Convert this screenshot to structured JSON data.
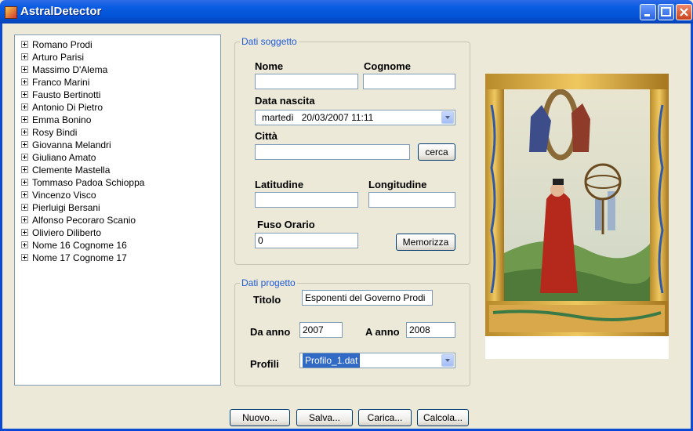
{
  "window": {
    "title": "AstralDetector"
  },
  "tree": {
    "items": [
      "Romano Prodi",
      "Arturo  Parisi",
      "Massimo D'Alema",
      "Franco Marini",
      "Fausto Bertinotti",
      "Antonio  Di Pietro",
      "Emma Bonino",
      "Rosy Bindi",
      "Giovanna Melandri",
      "Giuliano Amato",
      "Clemente Mastella",
      "Tommaso Padoa Schioppa",
      "Vincenzo Visco",
      "Pierluigi Bersani",
      "Alfonso  Pecoraro Scanio",
      "Oliviero  Diliberto",
      "Nome 16 Cognome 16",
      "Nome 17 Cognome 17"
    ]
  },
  "soggetto": {
    "legend": "Dati soggetto",
    "nome_label": "Nome",
    "nome_value": "",
    "cognome_label": "Cognome",
    "cognome_value": "",
    "data_label": "Data nascita",
    "data_day": "martedì",
    "data_value": "20/03/2007 11:11",
    "citta_label": "Città",
    "citta_value": "",
    "cerca_label": "cerca",
    "lat_label": "Latitudine",
    "lat_value": "",
    "lon_label": "Longitudine",
    "lon_value": "",
    "fuso_label": "Fuso Orario",
    "fuso_value": "0",
    "memorizza_label": "Memorizza"
  },
  "progetto": {
    "legend": "Dati progetto",
    "titolo_label": "Titolo",
    "titolo_value": "Esponenti del Governo Prodi",
    "da_anno_label": "Da anno",
    "da_anno_value": "2007",
    "a_anno_label": "A anno",
    "a_anno_value": "2008",
    "profili_label": "Profili",
    "profili_value": "Profilo_1.dat"
  },
  "buttons": {
    "nuovo": "Nuovo...",
    "salva": "Salva...",
    "carica": "Carica...",
    "calcola": "Calcola..."
  },
  "colors": {
    "titlebar": "#0a5ce3",
    "legend": "#1f5ad8",
    "selection": "#316ac5",
    "background": "#ece9d8"
  }
}
